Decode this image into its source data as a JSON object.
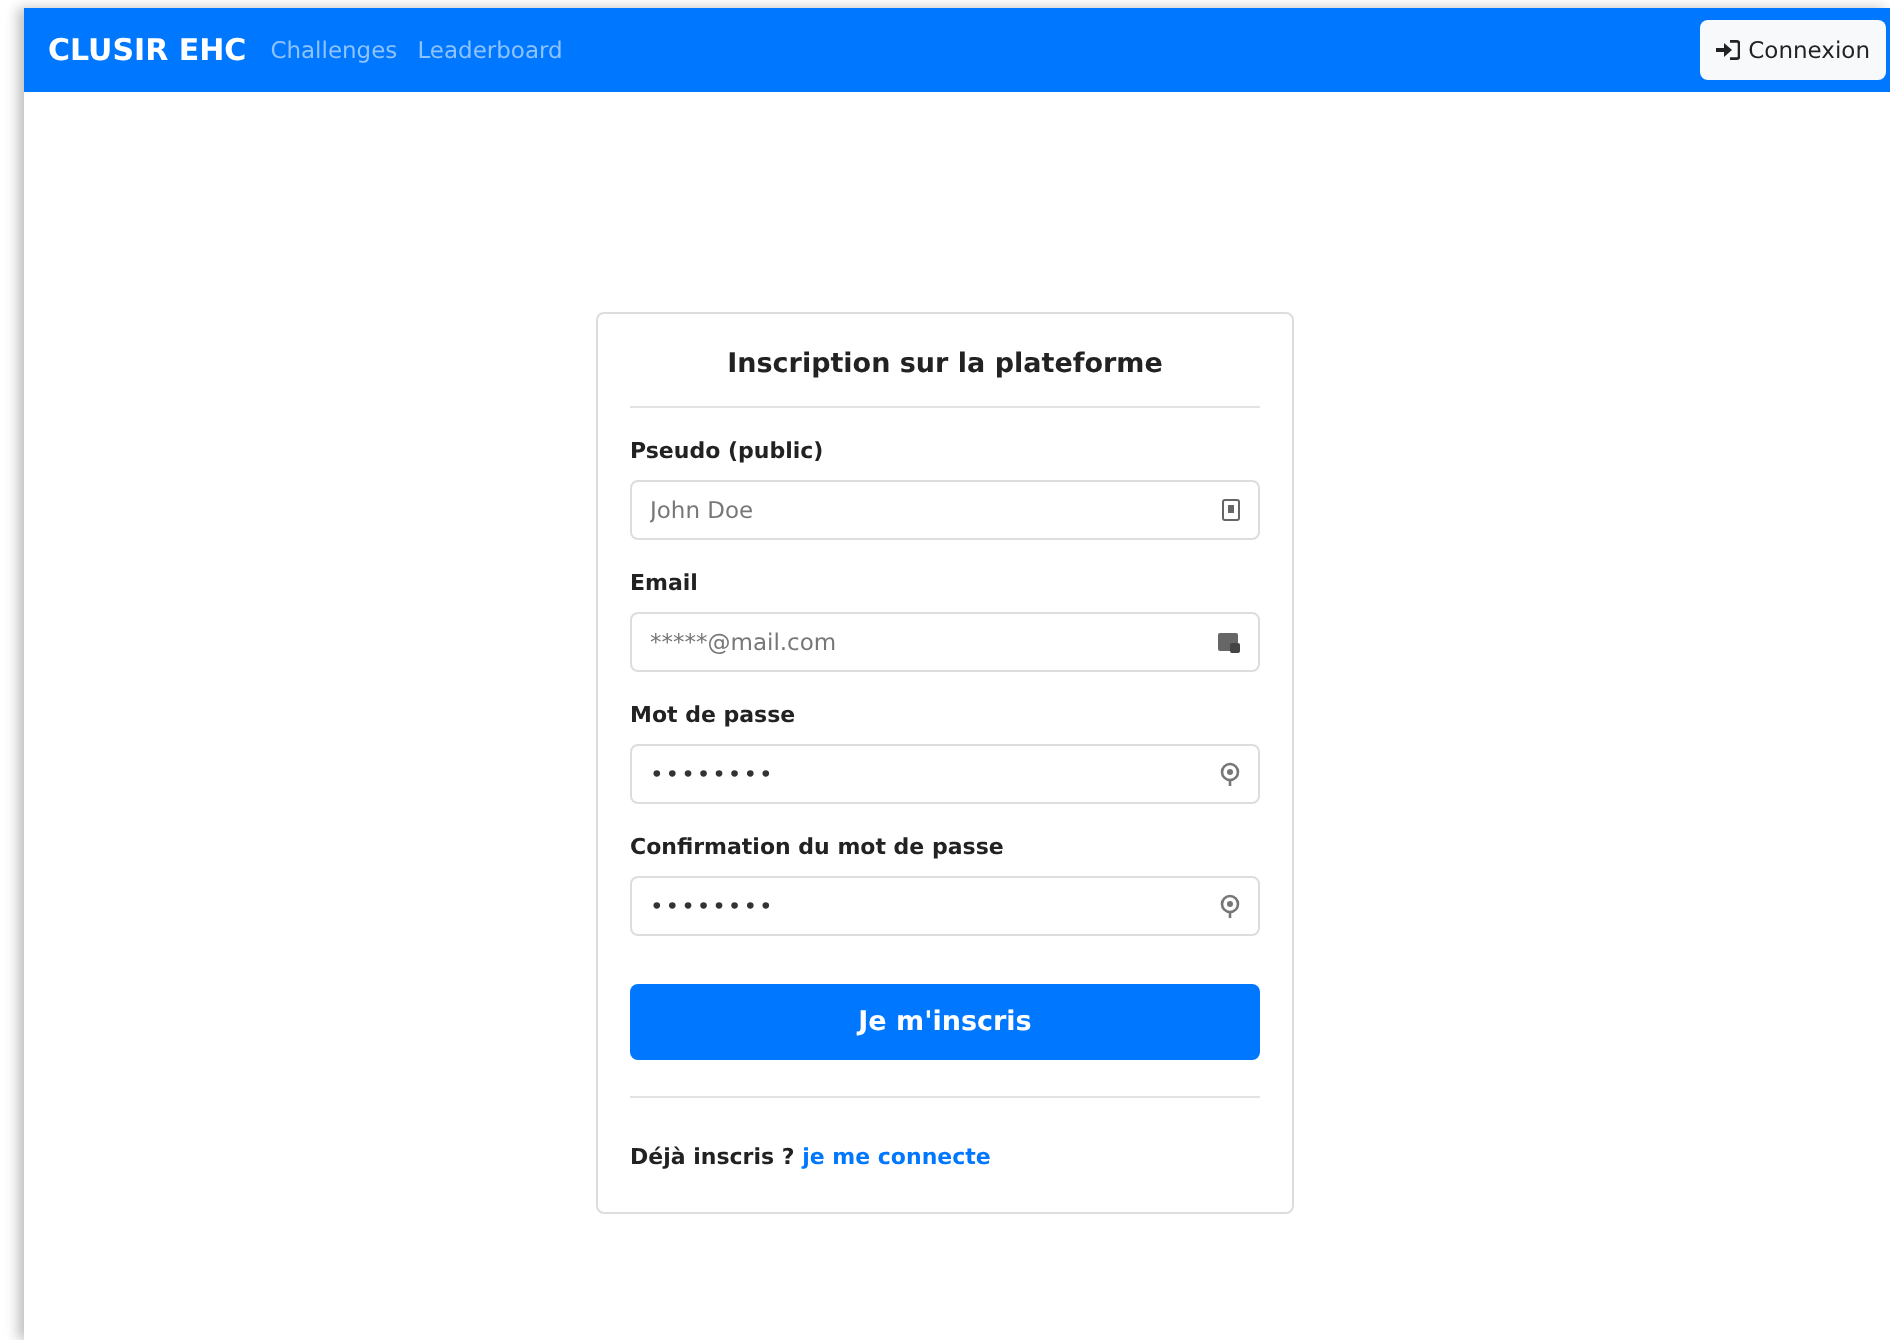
{
  "navbar": {
    "brand": "CLUSIR EHC",
    "links": [
      "Challenges",
      "Leaderboard"
    ],
    "login_button": "Connexion"
  },
  "form": {
    "title": "Inscription sur la plateforme",
    "fields": [
      {
        "label": "Pseudo (public)",
        "placeholder": "John Doe",
        "kind": "text"
      },
      {
        "label": "Email",
        "placeholder": "*****@mail.com",
        "kind": "text"
      },
      {
        "label": "Mot de passe",
        "placeholder": "••••••••",
        "kind": "password"
      },
      {
        "label": "Confirmation du mot de passe",
        "placeholder": "••••••••",
        "kind": "password"
      }
    ],
    "submit": "Je m'inscris",
    "footer_text": "Déjà inscris ?",
    "footer_link": "je me connecte"
  }
}
